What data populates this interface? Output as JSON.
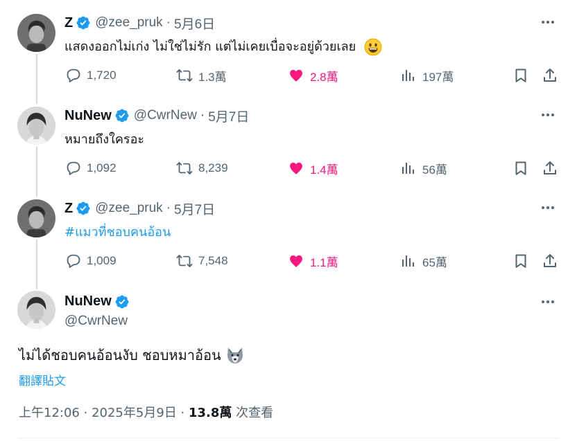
{
  "tweets": [
    {
      "name": "Z",
      "handle": "@zee_pruk",
      "date": "5月6日",
      "text": "แสดงออกไม่เก่ง ไม่ใช่ไม่รัก แต่ไม่เคยเบื่อจะอยู่ด้วยเลย",
      "emoji": "grinning-face",
      "replies": "1,720",
      "retweets": "1.3萬",
      "likes": "2.8萬",
      "views": "197萬",
      "liked": true
    },
    {
      "name": "NuNew",
      "handle": "@CwrNew",
      "date": "5月7日",
      "text": "หมายถึงใครอะ",
      "replies": "1,092",
      "retweets": "8,239",
      "likes": "1.4萬",
      "views": "56萬",
      "liked": true
    },
    {
      "name": "Z",
      "handle": "@zee_pruk",
      "date": "5月7日",
      "text": "#แมวที่ชอบคนอ้อน",
      "replies": "1,009",
      "retweets": "7,548",
      "likes": "1.1萬",
      "views": "65萬",
      "liked": true
    }
  ],
  "main": {
    "name": "NuNew",
    "handle": "@CwrNew",
    "text": "ไม่ได้ชอบคนอ้อนงับ ชอบหมาอ้อน",
    "emoji": "wolf-face",
    "translate_label": "翻譯貼文",
    "time": "上午12:06",
    "date": "2025年5月9日",
    "views_count": "13.8萬",
    "views_label": "次查看"
  },
  "colors": {
    "accent": "#1d9bf0",
    "like": "#f91880",
    "muted": "#536471",
    "text": "#0f1419",
    "thread_line": "#cfd9de"
  }
}
